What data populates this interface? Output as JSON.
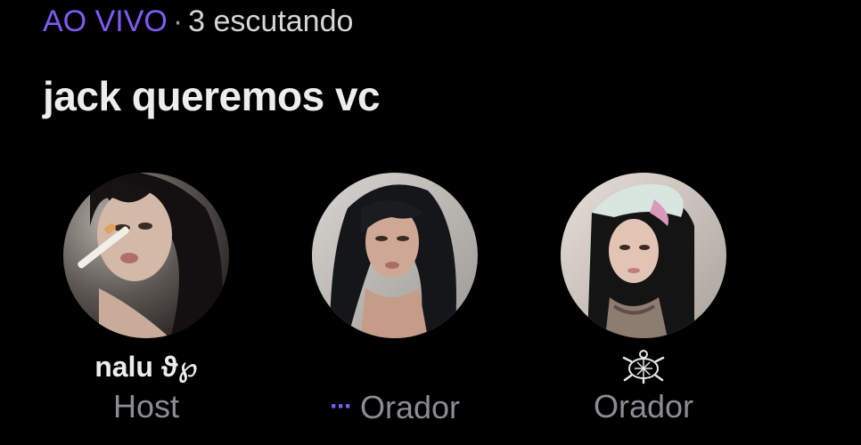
{
  "header": {
    "live_label": "AO VIVO",
    "separator": "·",
    "listeners": "3 escutando",
    "title": "jack queremos vc"
  },
  "participants": [
    {
      "name": "nalu ϑ℘",
      "role": "Host",
      "speaking": false,
      "avatar_icon": "profile-photo"
    },
    {
      "name": "",
      "role": "Orador",
      "speaking": true,
      "speaking_indicator": "···",
      "avatar_icon": "profile-photo"
    },
    {
      "name": "",
      "name_icon": "turtle-icon",
      "role": "Orador",
      "speaking": false,
      "avatar_icon": "profile-photo"
    }
  ],
  "colors": {
    "accent": "#7c5cf5",
    "background": "#000000",
    "title": "#ededee",
    "muted": "#8c8c92"
  }
}
